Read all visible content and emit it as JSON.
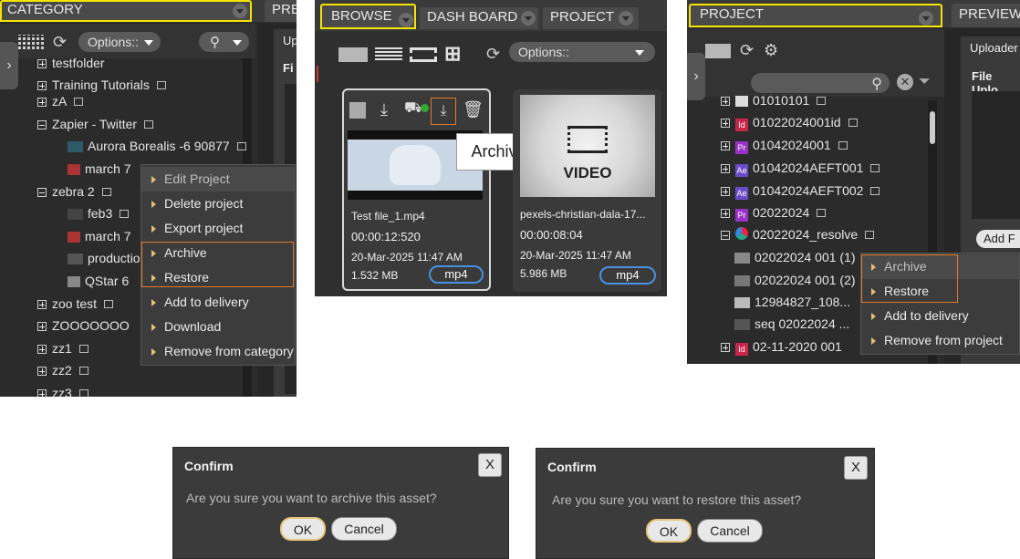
{
  "panel1": {
    "tabs": [
      "CATEGORY",
      "PRE"
    ],
    "options_label": "Options::",
    "tree": [
      {
        "label": "testfolder"
      },
      {
        "label": "Training Tutorials"
      },
      {
        "label": "zA"
      },
      {
        "label": "Zapier - Twitter"
      },
      {
        "label": "Aurora Borealis -6 90877"
      },
      {
        "label": "march 7"
      },
      {
        "label": "zebra 2"
      },
      {
        "label": "feb3"
      },
      {
        "label": "march 7"
      },
      {
        "label": "production"
      },
      {
        "label": "QStar 6"
      },
      {
        "label": "zoo test"
      },
      {
        "label": "ZOOOOOOO"
      },
      {
        "label": "zz1"
      },
      {
        "label": "zz2"
      },
      {
        "label": "zz3"
      }
    ],
    "menu": [
      "Edit Project",
      "Delete project",
      "Export project",
      "Archive",
      "Restore",
      "Add to delivery",
      "Download",
      "Remove from category"
    ],
    "right_peek": [
      "Up",
      "Fi"
    ]
  },
  "panel2": {
    "tabs": [
      "BROWSE",
      "DASH BOARD",
      "PROJECT"
    ],
    "options_label": "Options::",
    "tooltip": "Archive",
    "cards": [
      {
        "name": "Test file_1.mp4",
        "duration": "00:00:12:520",
        "date": "20-Mar-2025 11:47 AM",
        "size": "1.532 MB",
        "format": "mp4"
      },
      {
        "name": "pexels-christian-dala-17...",
        "duration": "00:00:08:04",
        "date": "20-Mar-2025 11:47 AM",
        "size": "5.986 MB",
        "format": "mp4",
        "thumb_label": "VIDEO"
      }
    ]
  },
  "panel3": {
    "tabs": [
      "PROJECT",
      "PREVIEW"
    ],
    "tree": [
      {
        "label": "01010101",
        "badge": ""
      },
      {
        "label": "01022024001id",
        "badge": "Id"
      },
      {
        "label": "01042024001",
        "badge": "Pr"
      },
      {
        "label": "01042024AEFT001",
        "badge": "Ae"
      },
      {
        "label": "01042024AEFT002",
        "badge": "Ae"
      },
      {
        "label": "02022024",
        "badge": "Pr"
      },
      {
        "label": "02022024_resolve",
        "badge": ""
      },
      {
        "label": "02022024 001 (1)",
        "badge": ""
      },
      {
        "label": "02022024 001 (2)",
        "badge": ""
      },
      {
        "label": "12984827_108...",
        "badge": ""
      },
      {
        "label": "seq 02022024 ...",
        "badge": ""
      },
      {
        "label": "02-11-2020 001",
        "badge": "Id"
      }
    ],
    "menu": [
      "Archive",
      "Restore",
      "Add to delivery",
      "Remove from project"
    ],
    "right_peek": {
      "tab": "Uploader",
      "title": "File Uplo",
      "button": "Add F"
    }
  },
  "dialogs": [
    {
      "title": "Confirm",
      "close": "X",
      "message": "Are you sure you want to archive this asset?",
      "ok": "OK",
      "cancel": "Cancel"
    },
    {
      "title": "Confirm",
      "close": "X",
      "message": "Are you sure you want to restore this asset?",
      "ok": "OK",
      "cancel": "Cancel"
    }
  ],
  "colors": {
    "highlight": "#f5e400",
    "menu_outline": "#e07a2a",
    "badge_blue": "#4a90e2",
    "id_badge": "#c8264a",
    "pr_badge": "#9a32c8",
    "ae_badge": "#6a4cc8"
  }
}
